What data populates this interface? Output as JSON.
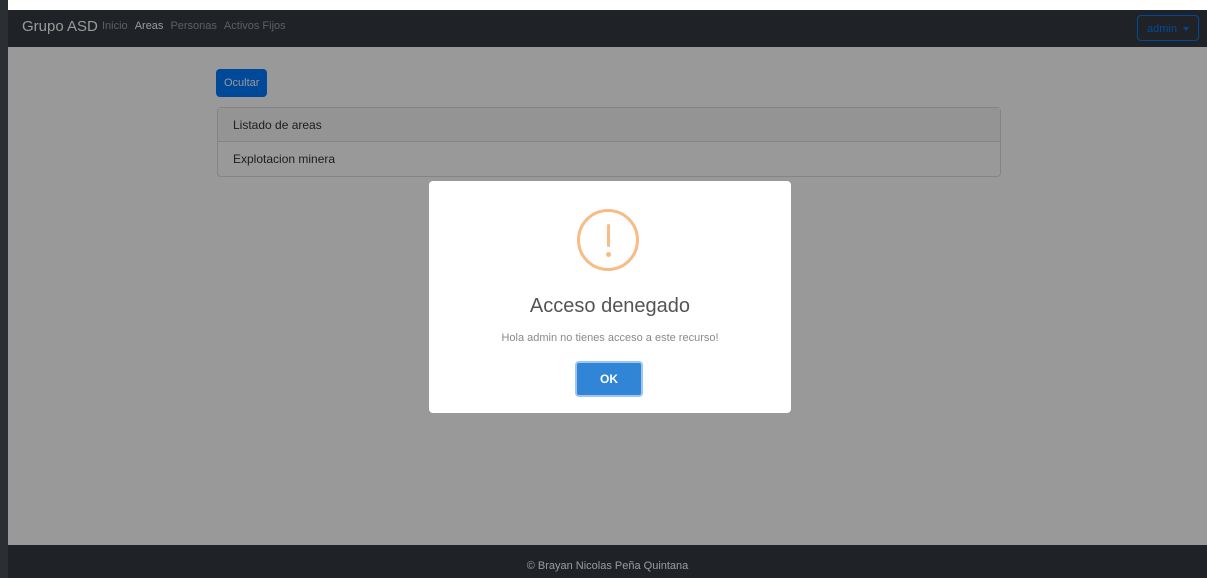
{
  "navbar": {
    "brand": "Grupo ASD",
    "links": [
      {
        "label": "Inicio"
      },
      {
        "label": "Areas"
      },
      {
        "label": "Personas"
      },
      {
        "label": "Activos Fijos"
      }
    ],
    "user_menu_label": "admin"
  },
  "content": {
    "hide_button_label": "Ocultar",
    "card_header": "Listado de areas",
    "rows": [
      "Explotacion minera"
    ]
  },
  "footer": {
    "text": "© Brayan Nicolas Peña Quintana"
  },
  "alert": {
    "icon": "warning-icon",
    "title": "Acceso denegado",
    "message": "Hola admin no tienes acceso a este recurso!",
    "confirm_label": "OK",
    "colors": {
      "icon": "#f8bb86",
      "confirm": "#3085d6"
    }
  }
}
